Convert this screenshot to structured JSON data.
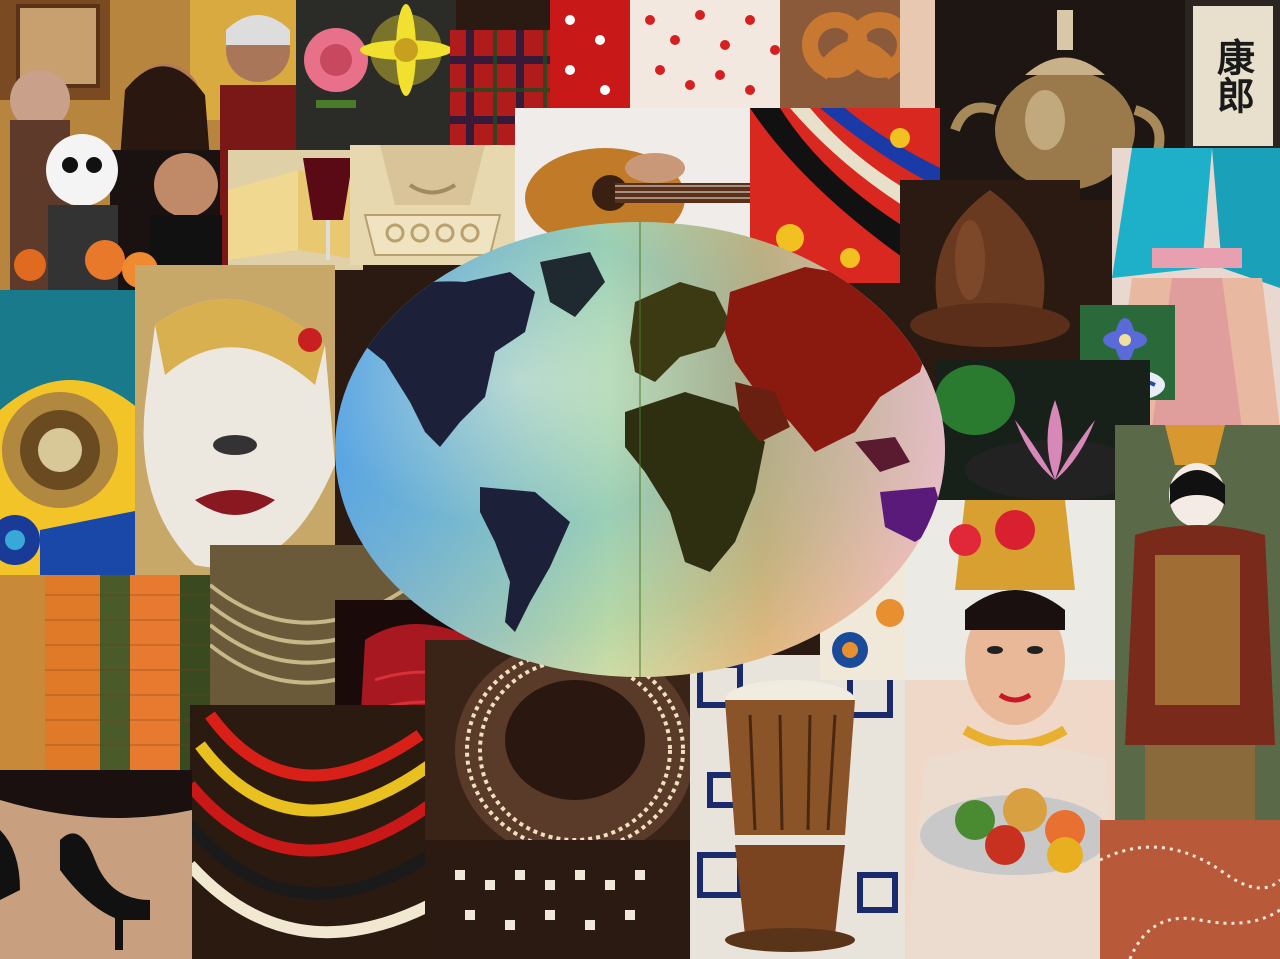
{
  "image": {
    "description_tag": "cultural-collage"
  },
  "sign": {
    "text": "康郎"
  },
  "colors": {
    "globe_land_dark": "#1c2038",
    "globe_land_green": "#3b3a12",
    "globe_land_red": "#8a1a10",
    "sky_blue": "#5fb6e0",
    "marigold": "#e67820"
  }
}
